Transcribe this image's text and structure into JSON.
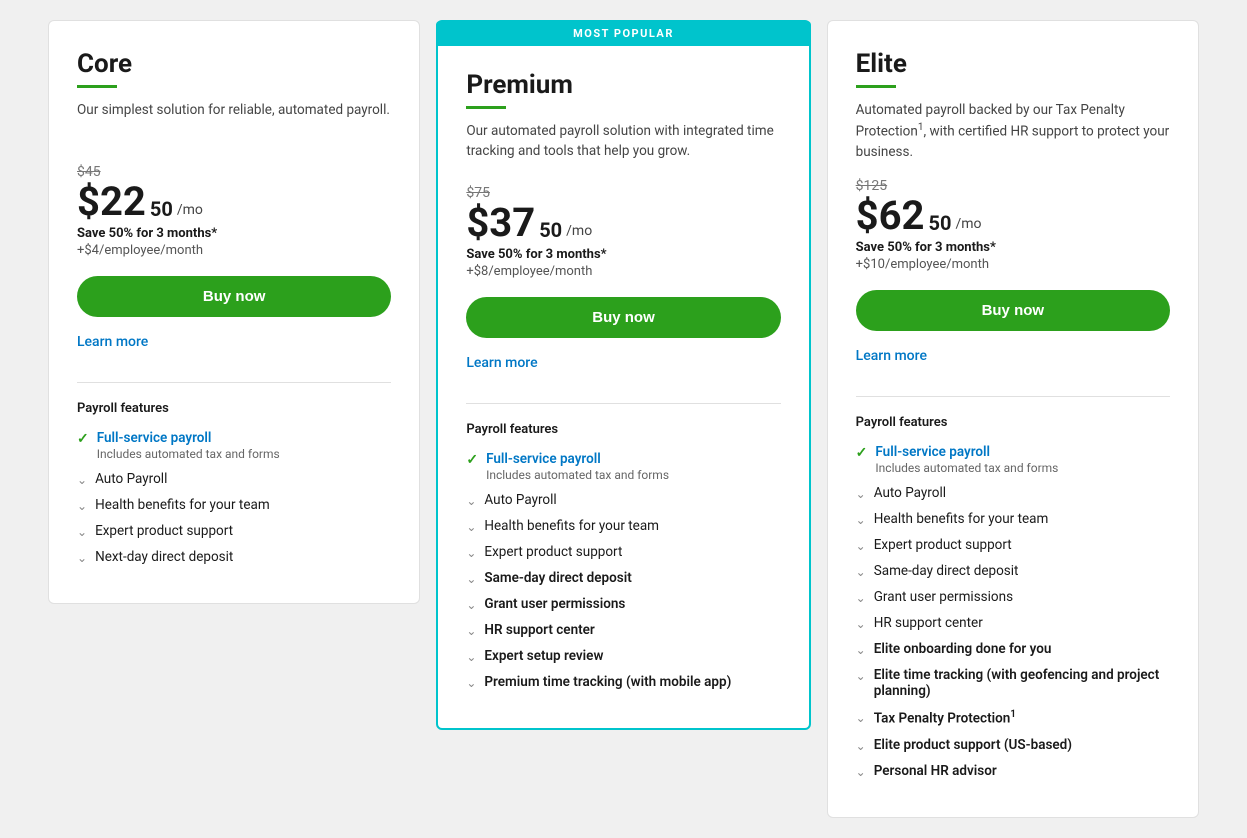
{
  "page": {
    "background": "#f0f0f0"
  },
  "plans": [
    {
      "id": "core",
      "popular": false,
      "title": "Core",
      "description": "Our simplest solution for reliable, automated payroll.",
      "original_price": "$45",
      "price_dollar": "$22",
      "price_cents": "50",
      "price_per": "/mo",
      "save_text": "Save 50% for 3 months*",
      "per_employee": "+$4/employee/month",
      "buy_label": "Buy now",
      "learn_more_label": "Learn more",
      "features_title": "Payroll features",
      "features": [
        {
          "type": "check",
          "text": "Full-service payroll",
          "highlight": true,
          "sub": "Includes automated tax and forms"
        },
        {
          "type": "chevron",
          "text": "Auto Payroll",
          "bold": false
        },
        {
          "type": "chevron",
          "text": "Health benefits for your team",
          "bold": false
        },
        {
          "type": "chevron",
          "text": "Expert product support",
          "bold": false
        },
        {
          "type": "chevron",
          "text": "Next-day direct deposit",
          "bold": false
        }
      ]
    },
    {
      "id": "premium",
      "popular": true,
      "popular_label": "MOST POPULAR",
      "title": "Premium",
      "description": "Our automated payroll solution with integrated time tracking and tools that help you grow.",
      "original_price": "$75",
      "price_dollar": "$37",
      "price_cents": "50",
      "price_per": "/mo",
      "save_text": "Save 50% for 3 months*",
      "per_employee": "+$8/employee/month",
      "buy_label": "Buy now",
      "learn_more_label": "Learn more",
      "features_title": "Payroll features",
      "features": [
        {
          "type": "check",
          "text": "Full-service payroll",
          "highlight": true,
          "sub": "Includes automated tax and forms"
        },
        {
          "type": "chevron",
          "text": "Auto Payroll",
          "bold": false
        },
        {
          "type": "chevron",
          "text": "Health benefits for your team",
          "bold": false
        },
        {
          "type": "chevron",
          "text": "Expert product support",
          "bold": false
        },
        {
          "type": "chevron",
          "text": "Same-day direct deposit",
          "bold": true
        },
        {
          "type": "chevron",
          "text": "Grant user permissions",
          "bold": true
        },
        {
          "type": "chevron",
          "text": "HR support center",
          "bold": true
        },
        {
          "type": "chevron",
          "text": "Expert setup review",
          "bold": true
        },
        {
          "type": "chevron",
          "text": "Premium time tracking (with mobile app)",
          "bold": true
        }
      ]
    },
    {
      "id": "elite",
      "popular": false,
      "title": "Elite",
      "description": "Automated payroll backed by our Tax Penalty Protection",
      "description_sup": "1",
      "description_end": ", with certified HR support to protect your business.",
      "original_price": "$125",
      "price_dollar": "$62",
      "price_cents": "50",
      "price_per": "/mo",
      "save_text": "Save 50% for 3 months*",
      "per_employee": "+$10/employee/month",
      "buy_label": "Buy now",
      "learn_more_label": "Learn more",
      "features_title": "Payroll features",
      "features": [
        {
          "type": "check",
          "text": "Full-service payroll",
          "highlight": true,
          "sub": "Includes automated tax and forms"
        },
        {
          "type": "chevron",
          "text": "Auto Payroll",
          "bold": false
        },
        {
          "type": "chevron",
          "text": "Health benefits for your team",
          "bold": false
        },
        {
          "type": "chevron",
          "text": "Expert product support",
          "bold": false
        },
        {
          "type": "chevron",
          "text": "Same-day direct deposit",
          "bold": false
        },
        {
          "type": "chevron",
          "text": "Grant user permissions",
          "bold": false
        },
        {
          "type": "chevron",
          "text": "HR support center",
          "bold": false
        },
        {
          "type": "chevron",
          "text": "Elite onboarding done for you",
          "bold": true
        },
        {
          "type": "chevron",
          "text": "Elite time tracking (with geofencing and project planning)",
          "bold": true
        },
        {
          "type": "chevron",
          "text": "Tax Penalty Protection",
          "bold": true,
          "sup": "1"
        },
        {
          "type": "chevron",
          "text": "Elite product support (US-based)",
          "bold": true
        },
        {
          "type": "chevron",
          "text": "Personal HR advisor",
          "bold": true
        }
      ]
    }
  ]
}
